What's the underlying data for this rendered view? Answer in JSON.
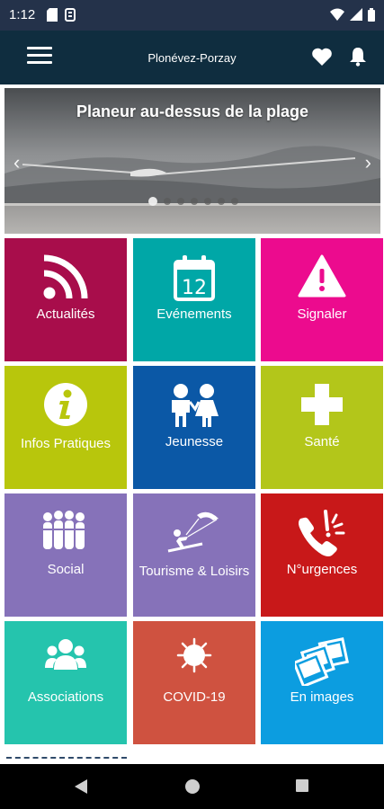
{
  "status_bar": {
    "time": "1:12",
    "icons_left": [
      "sd-card-icon",
      "storage-icon"
    ],
    "icons_right": [
      "wifi-icon",
      "signal-icon",
      "battery-icon"
    ]
  },
  "app_bar": {
    "title": "Plonévez-Porzay",
    "menu_icon": "hamburger-menu-icon",
    "favorite_icon": "heart-icon",
    "notification_icon": "bell-icon"
  },
  "carousel": {
    "title": "Planeur au-dessus de la plage",
    "slide_count": 7,
    "active_index": 0
  },
  "tiles": [
    {
      "label": "Actualités",
      "icon": "rss-icon",
      "color": "#a80d4b"
    },
    {
      "label": "Evénements",
      "icon": "calendar-icon",
      "calendar_day": "12",
      "color": "#00a7a7"
    },
    {
      "label": "Signaler",
      "icon": "warning-icon",
      "color": "#ec0b8e"
    },
    {
      "label": "Infos Pratiques",
      "icon": "info-icon",
      "color": "#b8c60c"
    },
    {
      "label": "Jeunesse",
      "icon": "children-icon",
      "color": "#0b58a6"
    },
    {
      "label": "Santé",
      "icon": "health-cross-icon",
      "color": "#b3c61a"
    },
    {
      "label": "Social",
      "icon": "people-group-icon",
      "color": "#8672b9"
    },
    {
      "label": "Tourisme & Loisirs",
      "icon": "kitesurf-icon",
      "color": "#8672b9"
    },
    {
      "label": "N°urgences",
      "icon": "emergency-phone-icon",
      "color": "#c81819"
    },
    {
      "label": "Associations",
      "icon": "associations-icon",
      "color": "#25c4ad"
    },
    {
      "label": "COVID-19",
      "icon": "virus-icon",
      "color": "#cf5240"
    },
    {
      "label": "En images",
      "icon": "photos-icon",
      "color": "#0c9de0"
    }
  ],
  "nav_bar": {
    "back_icon": "back-triangle-icon",
    "home_icon": "home-circle-icon",
    "recents_icon": "recents-square-icon"
  }
}
